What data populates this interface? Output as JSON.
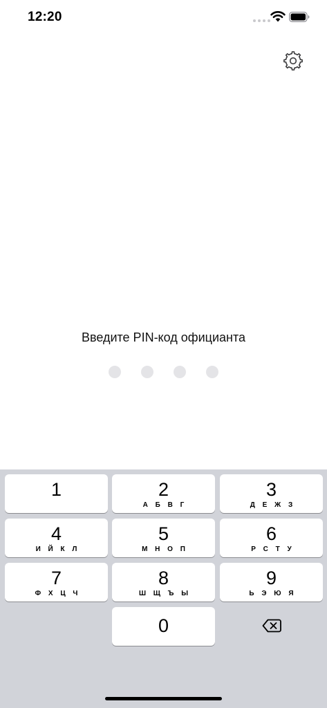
{
  "status_bar": {
    "time": "12:20",
    "icons": [
      "signal-dots-icon",
      "wifi-icon",
      "battery-icon"
    ]
  },
  "header": {
    "settings_icon": "gear-icon"
  },
  "pin": {
    "prompt": "Введите PIN-код официанта",
    "length": 4,
    "entered": 0
  },
  "keypad": {
    "keys": [
      {
        "digit": "1",
        "letters": ""
      },
      {
        "digit": "2",
        "letters": "А Б В Г"
      },
      {
        "digit": "3",
        "letters": "Д Е Ж З"
      },
      {
        "digit": "4",
        "letters": "И Й К Л"
      },
      {
        "digit": "5",
        "letters": "М Н О П"
      },
      {
        "digit": "6",
        "letters": "Р С Т У"
      },
      {
        "digit": "7",
        "letters": "Ф Х Ц Ч"
      },
      {
        "digit": "8",
        "letters": "Ш Щ Ъ Ы"
      },
      {
        "digit": "9",
        "letters": "Ь Э Ю Я"
      },
      {
        "digit": "0",
        "letters": ""
      }
    ],
    "delete_icon": "backspace-icon"
  },
  "colors": {
    "keypad_background": "#d1d3d9",
    "key_background": "#ffffff",
    "dot_empty": "#e4e4e7"
  }
}
